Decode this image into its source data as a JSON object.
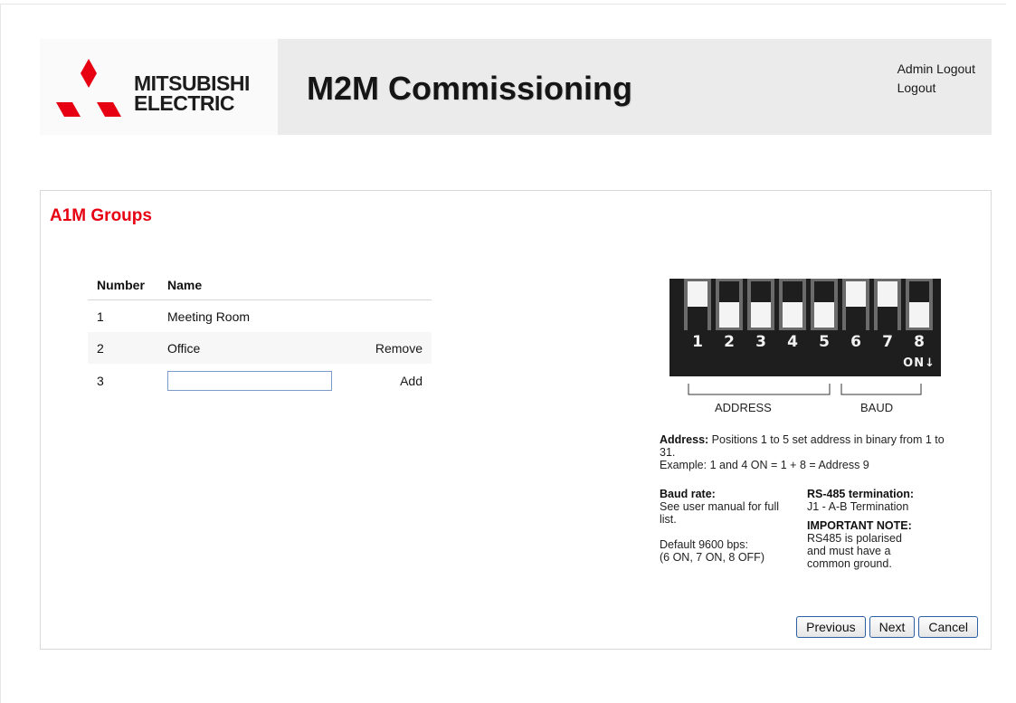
{
  "header": {
    "logo_line1": "MITSUBISHI",
    "logo_line2": "ELECTRIC",
    "logo_color": "#e60012",
    "title": "M2M Commissioning",
    "links": [
      "Admin Logout",
      "Logout"
    ]
  },
  "panel": {
    "title": "A1M Groups",
    "title_color": "#e60012",
    "table": {
      "headers": [
        "Number",
        "Name"
      ],
      "rows": [
        {
          "number": "1",
          "name": "Meeting Room",
          "action": ""
        },
        {
          "number": "2",
          "name": "Office",
          "action": "Remove"
        },
        {
          "number": "3",
          "name": "",
          "action": "Add"
        }
      ],
      "input_value": ""
    }
  },
  "dip_switch": {
    "positions": [
      "1",
      "2",
      "3",
      "4",
      "5",
      "6",
      "7",
      "8"
    ],
    "on_label": "ON↓",
    "state": [
      "up",
      "down",
      "down",
      "down",
      "down",
      "up",
      "up",
      "down"
    ],
    "address_label": "ADDRESS",
    "baud_label": "BAUD"
  },
  "info": {
    "address_heading": "Address:",
    "address_text": " Positions 1 to 5 set address in binary from 1 to 31.",
    "address_example": "Example: 1 and 4 ON = 1 + 8 = Address 9",
    "baud_heading": "Baud rate:",
    "baud_text": "See user manual for full list.",
    "baud_default_1": "Default 9600 bps:",
    "baud_default_2": "(6 ON, 7 ON, 8 OFF)",
    "rs485_heading": "RS-485 termination:",
    "rs485_text": "J1 - A-B Termination",
    "note_heading": "IMPORTANT NOTE:",
    "note_text": "RS485 is polarised and must have a common ground."
  },
  "buttons": {
    "previous": "Previous",
    "next": "Next",
    "cancel": "Cancel"
  }
}
